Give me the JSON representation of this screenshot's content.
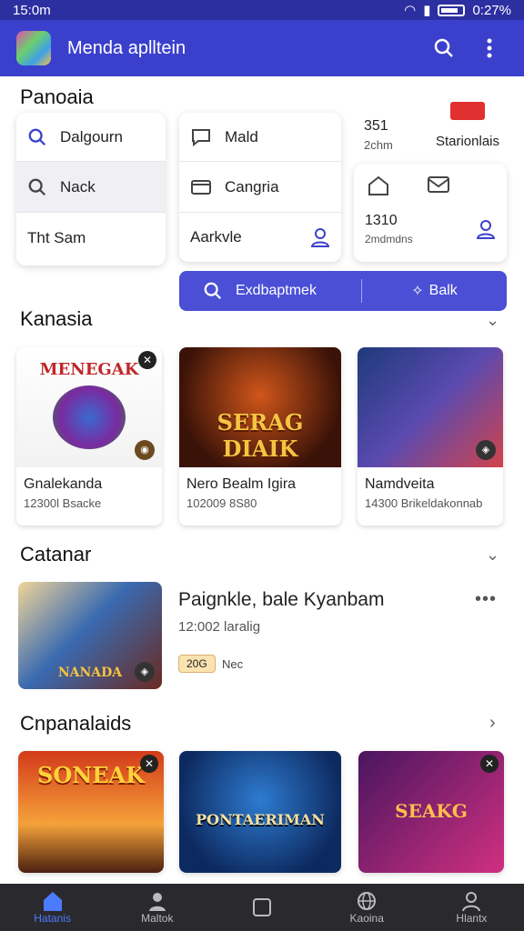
{
  "status": {
    "time": "15:0m",
    "right_time": "0:27%"
  },
  "appbar": {
    "title": "Menda aplltein"
  },
  "sections": {
    "s1": "Panoaia",
    "s2": "Kanasia",
    "s3": "Catanar",
    "s4": "Cnpanalaids"
  },
  "search_card": {
    "items": [
      {
        "label": "Dalgourn",
        "icon": "search-icon"
      },
      {
        "label": "Nack",
        "icon": "search-icon"
      },
      {
        "label": "Tht Sam",
        "icon": ""
      }
    ]
  },
  "menu_card": {
    "items": [
      {
        "label": "Mald",
        "icon": "heart-chat-icon"
      },
      {
        "label": "Cangria",
        "icon": "card-icon"
      },
      {
        "label": "Aarkvle",
        "icon": "user-icon"
      }
    ]
  },
  "stats_top": {
    "value": "351",
    "sub": "2chm",
    "label": "Starionlais"
  },
  "stats_card": {
    "value": "1310",
    "sub": "2mdmdns"
  },
  "action": {
    "left_label": "Exdbaptmek",
    "right_label": "Balk"
  },
  "games1": [
    {
      "name": "Gnalekanda",
      "sub": "12300l Bsacke",
      "art": "MENEGAK",
      "colors": [
        "#ffffff",
        "#f0f0f0"
      ]
    },
    {
      "name": "Nero Bealm Igira",
      "sub": "102009 8S80",
      "art": "SERAG DIAIK",
      "colors": [
        "#3a1208",
        "#d0561a"
      ]
    },
    {
      "name": "Namdveita",
      "sub": "14300 Brikeldakonnab",
      "art": "",
      "colors": [
        "#1e3a7a",
        "#d2434a"
      ]
    }
  ],
  "featured": {
    "title": "Paignkle, bale Kyanbam",
    "sub": "12:002 laralig",
    "tag": "20G",
    "tag_label": "Nec",
    "art": "NANADA"
  },
  "games2": [
    {
      "art": "SONEAK",
      "colors": [
        "#d33a1a",
        "#f5a23a"
      ]
    },
    {
      "art": "PONTAERIMAN",
      "colors": [
        "#0d2a60",
        "#2e7bd0"
      ]
    },
    {
      "art": "SEAKG",
      "colors": [
        "#4a1560",
        "#d03080"
      ]
    }
  ],
  "nav": [
    {
      "label": "Hatanis",
      "icon": "home-icon"
    },
    {
      "label": "Maltok",
      "icon": "person-icon"
    },
    {
      "label": "",
      "icon": "square-icon"
    },
    {
      "label": "Kaoina",
      "icon": "globe-icon"
    },
    {
      "label": "Hlantx",
      "icon": "profile-icon"
    }
  ]
}
